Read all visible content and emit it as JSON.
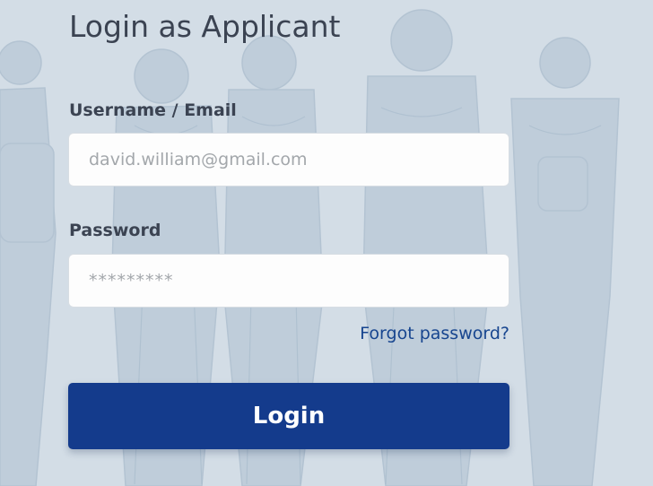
{
  "page": {
    "title": "Login as Applicant"
  },
  "form": {
    "username_label": "Username / Email",
    "username_placeholder": "david.william@gmail.com",
    "password_label": "Password",
    "password_placeholder": "*********",
    "forgot_link": "Forgot password?",
    "login_button": "Login"
  },
  "colors": {
    "background": "#d3dde6",
    "primary": "#143b8c",
    "link": "#17458f",
    "text": "#3b4352"
  },
  "decoration": {
    "background_art": "sketch-of-people-walking"
  }
}
